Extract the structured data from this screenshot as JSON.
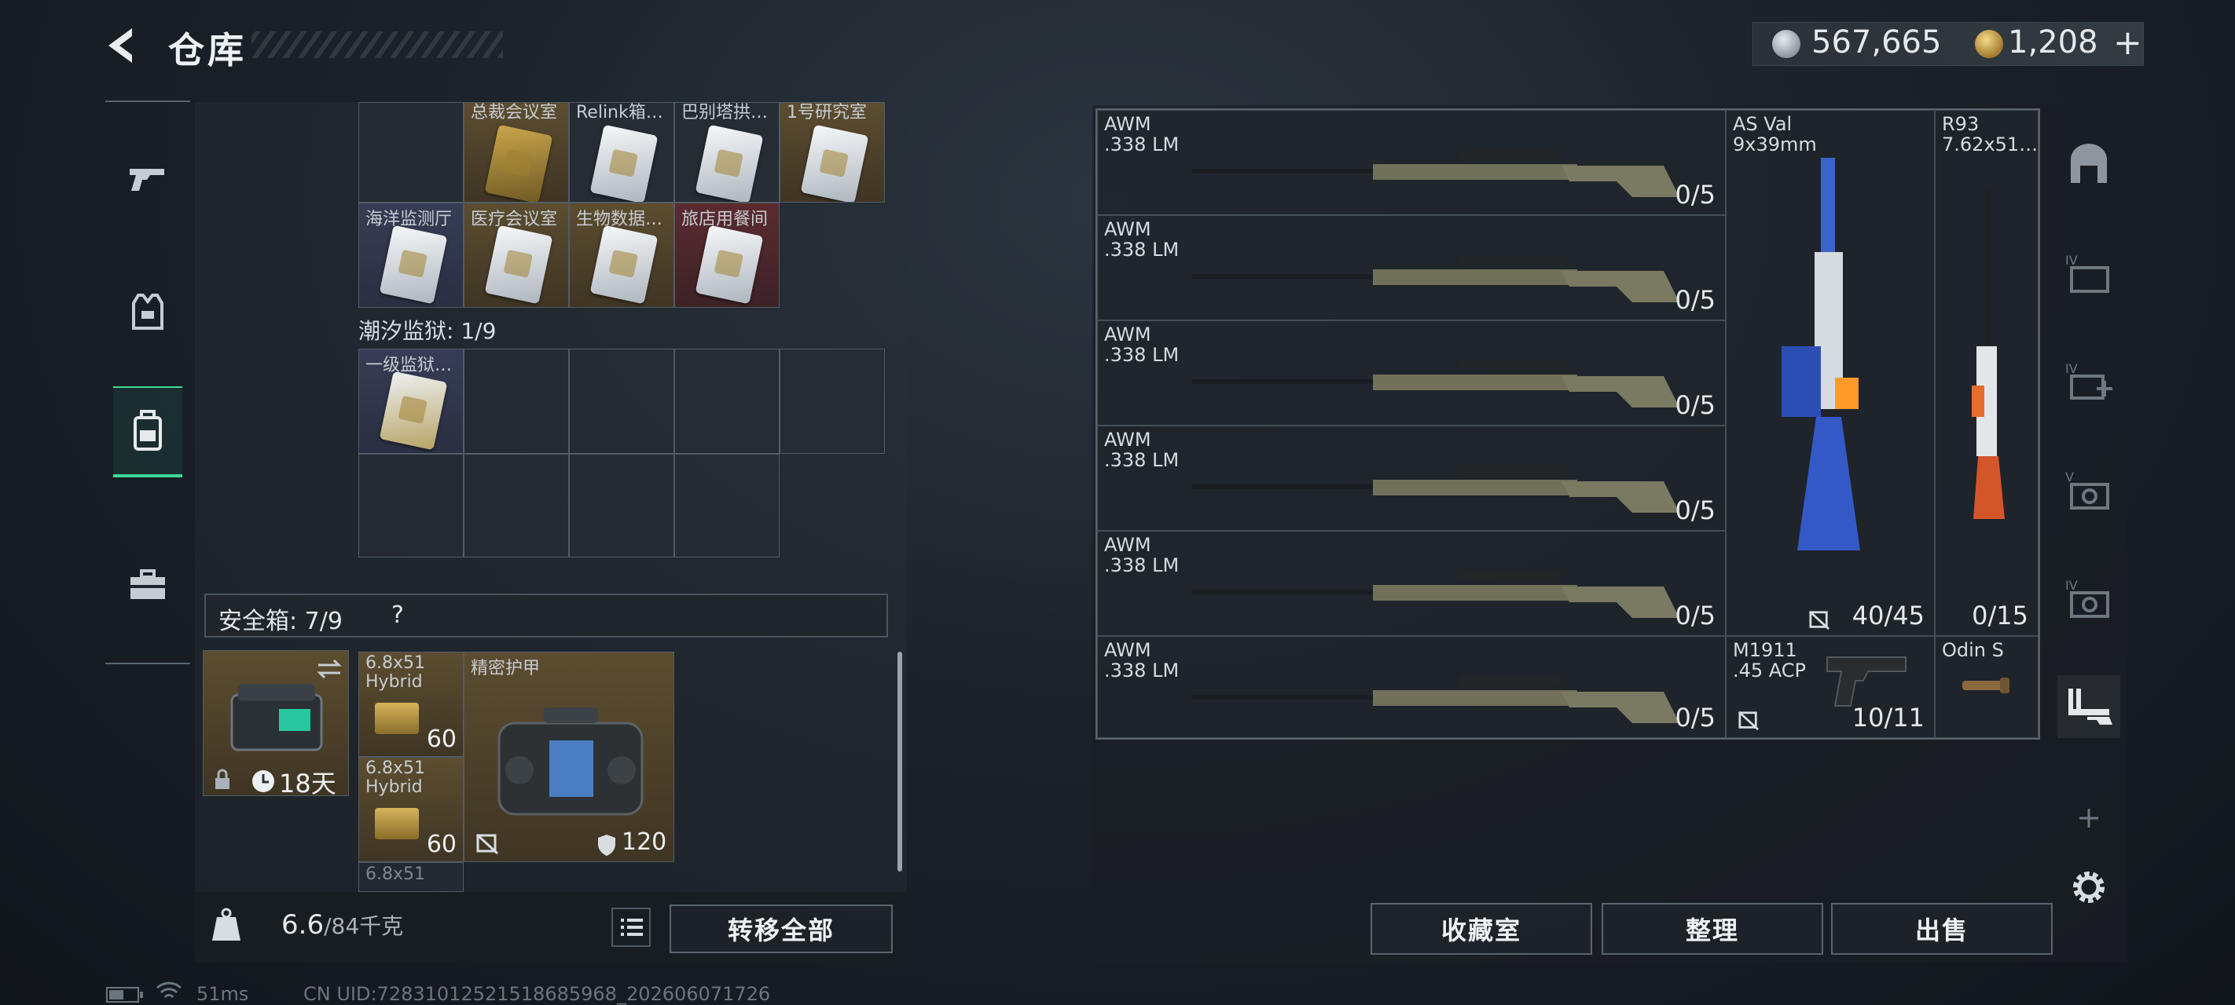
{
  "header": {
    "title": "仓库",
    "currency_silver": "567,665",
    "currency_gold": "1,208"
  },
  "left": {
    "top_row_labels": [
      "总裁会议室",
      "Relink箱…",
      "巴别塔拱…",
      "1号研究室"
    ],
    "second_row_labels": [
      "海洋监测厅",
      "医疗会议室",
      "生物数据…",
      "旅店用餐间"
    ],
    "section_prison": "潮汐监狱: 1/9",
    "prison_item": "一级监狱…",
    "safe_box": {
      "label": "安全箱: 7/9",
      "help": "?",
      "days": "18天"
    },
    "items": [
      {
        "name": "6.8x51\nHybrid",
        "count": "60"
      },
      {
        "name": "6.8x51\nHybrid",
        "count": "60"
      },
      {
        "name": "6.8x51",
        "count": ""
      }
    ],
    "armor": {
      "name": "精密护甲",
      "durability": "120"
    },
    "weight": {
      "current": "6.6",
      "max": "/84千克"
    },
    "transfer_all": "转移全部"
  },
  "right": {
    "weapons": [
      {
        "name": "AWM\n.338 LM",
        "count": "0/5"
      },
      {
        "name": "AWM\n.338 LM",
        "count": "0/5"
      },
      {
        "name": "AWM\n.338 LM",
        "count": "0/5"
      },
      {
        "name": "AWM\n.338 LM",
        "count": "0/5"
      },
      {
        "name": "AWM\n.338 LM",
        "count": "0/5"
      },
      {
        "name": "AWM\n.338 LM",
        "count": "0/5"
      }
    ],
    "asval": {
      "name": "AS Val\n9x39mm",
      "count": "40/45"
    },
    "r93": {
      "name": "R93\n7.62x51…",
      "count": "0/15"
    },
    "m1911": {
      "name": "M1911\n.45 ACP",
      "count": "10/11"
    },
    "odin": {
      "name": "Odin S"
    },
    "buttons": {
      "collection": "收藏室",
      "sort": "整理",
      "sell": "出售"
    }
  },
  "status": {
    "ping": "51ms",
    "uid": "CN UID:7283101252151868596​8_202606071726"
  }
}
